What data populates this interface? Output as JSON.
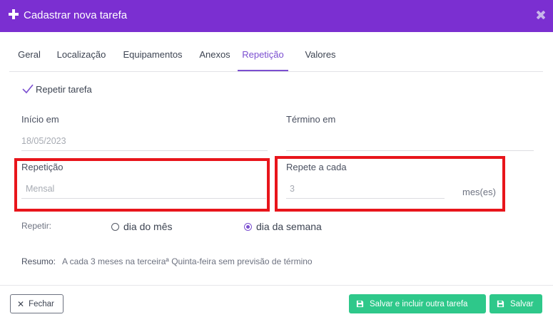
{
  "modal": {
    "title": "Cadastrar nova tarefa"
  },
  "tabs": [
    {
      "label": "Geral"
    },
    {
      "label": "Localização"
    },
    {
      "label": "Equipamentos"
    },
    {
      "label": "Anexos"
    },
    {
      "label": "Repetição",
      "active": true
    },
    {
      "label": "Valores"
    }
  ],
  "repeat_task": {
    "label": "Repetir tarefa",
    "checked": true
  },
  "fields": {
    "start": {
      "label": "Início em",
      "value": "18/05/2023"
    },
    "end": {
      "label": "Término em",
      "value": ""
    },
    "repetition": {
      "label": "Repetição",
      "value": "Mensal"
    },
    "repeat_every": {
      "label": "Repete a cada",
      "value": "3",
      "unit": "mes(es)"
    }
  },
  "repeat_on": {
    "label": "Repetir:",
    "options": [
      {
        "label": "dia do mês",
        "selected": false
      },
      {
        "label": "dia da semana",
        "selected": true
      }
    ]
  },
  "summary": {
    "label": "Resumo:",
    "text": "A cada 3 meses na terceiraª Quinta-feira sem previsão de término"
  },
  "buttons": {
    "close": "Fechar",
    "save_and_include": "Salvar e incluir outra tarefa",
    "save": "Salvar"
  },
  "colors": {
    "header": "#7b2fd1",
    "accent": "#7b4fd0",
    "success": "#2ec88a",
    "highlight": "#e8151b"
  }
}
